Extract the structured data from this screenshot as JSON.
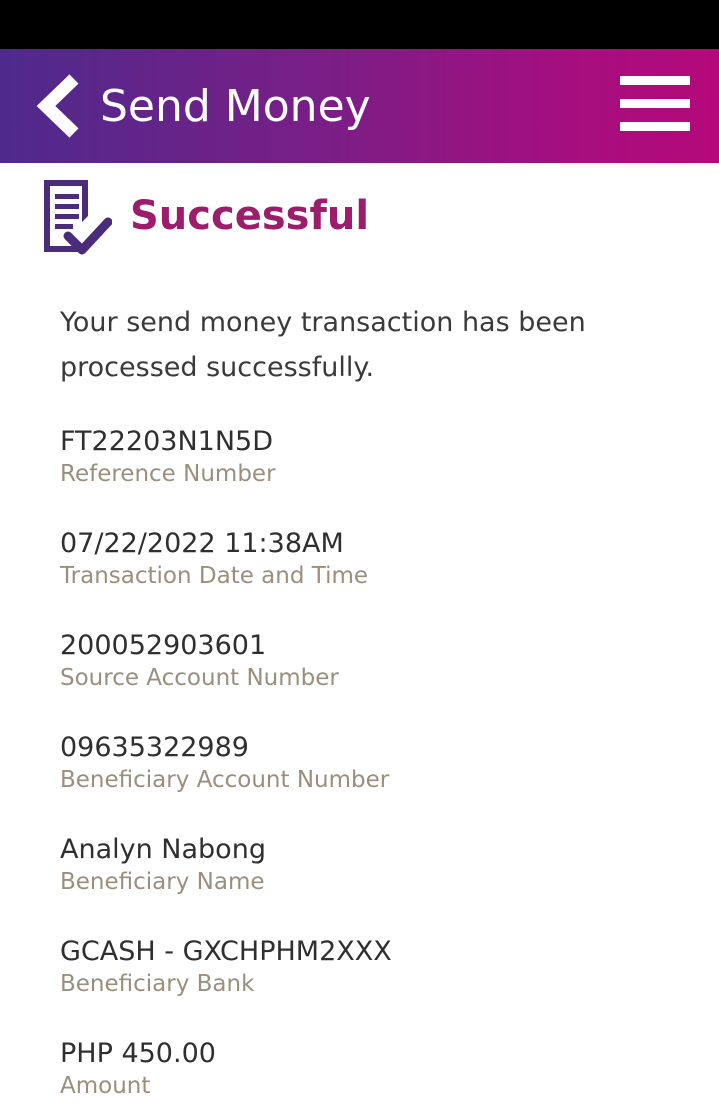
{
  "header": {
    "title": "Send Money"
  },
  "status": {
    "title": "Successful",
    "message": "Your send money transaction has been processed successfully."
  },
  "details": [
    {
      "value": "FT22203N1N5D",
      "label": "Reference Number"
    },
    {
      "value": "07/22/2022 11:38AM",
      "label": "Transaction Date and Time"
    },
    {
      "value": "200052903601",
      "label": "Source Account Number"
    },
    {
      "value": "09635322989",
      "label": "Beneficiary Account Number"
    },
    {
      "value": "Analyn Nabong",
      "label": "Beneficiary Name"
    },
    {
      "value": "GCASH - GXCHPHM2XXX",
      "label": "Beneficiary Bank"
    },
    {
      "value": "PHP 450.00",
      "label": "Amount"
    }
  ],
  "icons": {
    "back": "chevron-left-icon",
    "menu": "hamburger-menu-icon",
    "status": "receipt-check-icon"
  },
  "colors": {
    "header_gradient_start": "#4e2a8c",
    "header_gradient_end": "#b5097a",
    "status_title": "#9b1d6b",
    "icon": "#4b2c7a",
    "value_text": "#2f2f2f",
    "label_text": "#9a8f7f"
  }
}
